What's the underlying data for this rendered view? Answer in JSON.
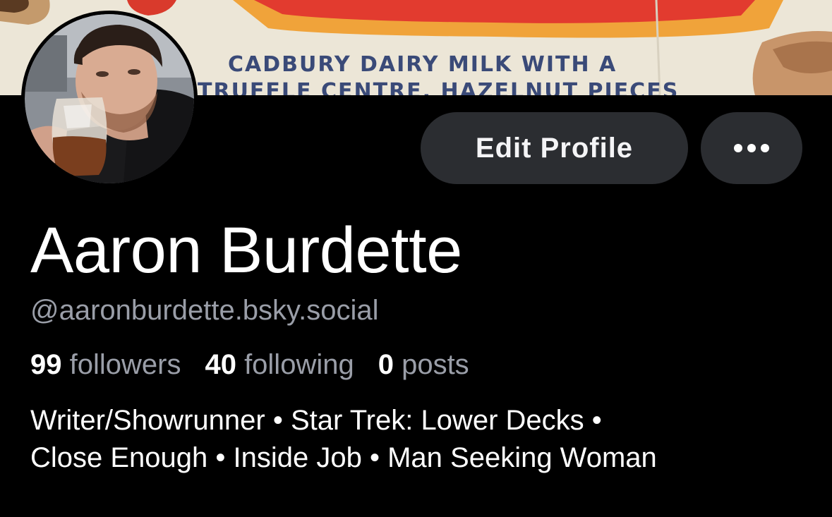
{
  "banner": {
    "image_text_line1": "CADBURY DAIRY MILK WITH A",
    "image_text_line2": "TRUFFLE CENTRE, HAZELNUT PIECES"
  },
  "profile": {
    "display_name": "Aaron Burdette",
    "handle": "@aaronburdette.bsky.social",
    "stats": {
      "followers_count": "99",
      "followers_label": "followers",
      "following_count": "40",
      "following_label": "following",
      "posts_count": "0",
      "posts_label": "posts"
    },
    "bio": {
      "line1": "Writer/Showrunner • Star Trek: Lower Decks •",
      "line2": "Close Enough • Inside Job • Man Seeking Woman"
    }
  },
  "actions": {
    "edit_profile_label": "Edit Profile",
    "more_icon": "ellipsis-icon"
  },
  "colors": {
    "background": "#000000",
    "button_bg": "#2b2d31",
    "secondary_text": "#9a9ea8"
  }
}
